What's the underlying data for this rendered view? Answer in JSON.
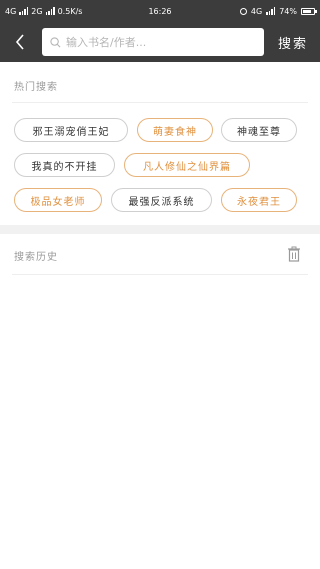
{
  "status_bar": {
    "network_1": "4G",
    "network_2": "2G",
    "speed": "0.5K/s",
    "time": "16:26",
    "right_network": "4G",
    "battery": "74%"
  },
  "toolbar": {
    "search_placeholder": "输入书名/作者...",
    "search_label": "搜索"
  },
  "hot_search": {
    "title": "热门搜索",
    "tags": [
      {
        "label": "邪王溺宠俏王妃",
        "highlight": false
      },
      {
        "label": "萌妻食神",
        "highlight": true
      },
      {
        "label": "神魂至尊",
        "highlight": false
      },
      {
        "label": "我真的不开挂",
        "highlight": false
      },
      {
        "label": "凡人修仙之仙界篇",
        "highlight": true
      },
      {
        "label": "极品女老师",
        "highlight": true
      },
      {
        "label": "最强反派系统",
        "highlight": false
      },
      {
        "label": "永夜君王",
        "highlight": true
      }
    ]
  },
  "history": {
    "title": "搜索历史"
  },
  "colors": {
    "header_bg": "#3c3c3c",
    "accent": "#e0903e",
    "tag_border": "#cfcfcf"
  }
}
